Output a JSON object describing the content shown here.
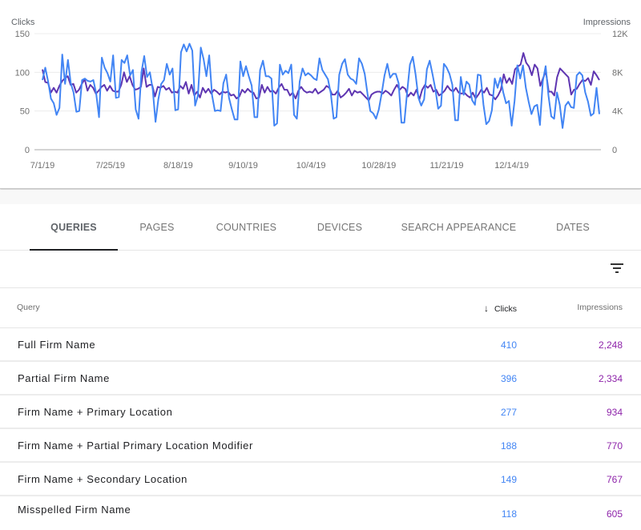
{
  "chart_data": {
    "type": "line",
    "title": "",
    "left_axis": {
      "label": "Clicks",
      "ticks": [
        "0",
        "50",
        "100",
        "150"
      ],
      "range": [
        0,
        150
      ]
    },
    "right_axis": {
      "label": "Impressions",
      "ticks": [
        "0",
        "4K",
        "8K",
        "12K"
      ],
      "range": [
        0,
        12000
      ]
    },
    "x_ticks": [
      "7/1/19",
      "7/25/19",
      "8/18/19",
      "9/10/19",
      "10/4/19",
      "10/28/19",
      "11/21/19",
      "12/14/19"
    ],
    "x_range": [
      "7/1/19",
      "12/31/19"
    ],
    "grid": true,
    "series": [
      {
        "name": "Clicks",
        "axis": "left",
        "color": "#4285f4",
        "values": [
          90,
          106,
          88,
          66,
          60,
          45,
          54,
          123,
          85,
          116,
          86,
          74,
          49,
          50,
          90,
          92,
          89,
          88,
          90,
          73,
          42,
          119,
          106,
          99,
          88,
          122,
          67,
          68,
          116,
          112,
          122,
          96,
          103,
          52,
          40,
          100,
          121,
          94,
          100,
          78,
          36,
          65,
          85,
          90,
          111,
          97,
          105,
          51,
          52,
          126,
          136,
          127,
          137,
          128,
          57,
          70,
          132,
          117,
          95,
          122,
          70,
          50,
          51,
          50,
          86,
          97,
          67,
          52,
          39,
          39,
          114,
          95,
          108,
          95,
          83,
          42,
          42,
          103,
          115,
          95,
          95,
          92,
          31,
          34,
          110,
          97,
          102,
          99,
          110,
          45,
          40,
          88,
          105,
          96,
          99,
          96,
          92,
          90,
          118,
          103,
          97,
          91,
          73,
          40,
          42,
          97,
          111,
          117,
          97,
          92,
          90,
          85,
          118,
          111,
          98,
          72,
          50,
          47,
          40,
          52,
          73,
          96,
          111,
          93,
          98,
          98,
          86,
          35,
          35,
          74,
          110,
          120,
          97,
          67,
          57,
          65,
          104,
          115,
          97,
          78,
          53,
          57,
          111,
          106,
          98,
          84,
          38,
          38,
          94,
          71,
          88,
          84,
          64,
          58,
          97,
          96,
          58,
          33,
          37,
          51,
          92,
          80,
          93,
          74,
          60,
          63,
          31,
          63,
          109,
          92,
          109,
          80,
          62,
          46,
          56,
          58,
          32,
          88,
          108,
          70,
          43,
          40,
          74,
          58,
          28,
          57,
          62,
          55,
          54,
          96,
          100,
          96,
          74,
          62,
          44,
          47,
          80,
          46
        ],
        "values_note": "approximate daily values read from chart"
      },
      {
        "name": "Impressions",
        "axis": "right",
        "color": "#5e35b1",
        "values": [
          8300,
          7000,
          6900,
          5900,
          6400,
          5900,
          6600,
          7100,
          7400,
          7600,
          6700,
          6800,
          5900,
          6200,
          6800,
          7300,
          6100,
          6700,
          6400,
          5800,
          6100,
          6500,
          6700,
          6100,
          6600,
          6100,
          6000,
          6000,
          6700,
          8000,
          7000,
          7600,
          6700,
          6200,
          6300,
          6500,
          8400,
          6500,
          6700,
          6700,
          5500,
          6500,
          6400,
          6600,
          6200,
          6400,
          5900,
          6000,
          5900,
          6600,
          6300,
          7000,
          5800,
          6700,
          5600,
          6000,
          5400,
          6400,
          5900,
          6300,
          5800,
          6200,
          6000,
          5700,
          6000,
          5900,
          6000,
          5600,
          5700,
          5300,
          5500,
          6200,
          5900,
          6300,
          6000,
          5900,
          5300,
          5400,
          6700,
          5900,
          6500,
          6000,
          6100,
          5800,
          6400,
          6800,
          6200,
          6200,
          5600,
          5900,
          5300,
          6100,
          6500,
          6100,
          5900,
          6000,
          5900,
          6300,
          5800,
          6000,
          6200,
          6600,
          6400,
          5700,
          5700,
          6100,
          5400,
          5600,
          5900,
          6300,
          5600,
          6100,
          5900,
          6000,
          5700,
          5400,
          5100,
          5700,
          5900,
          6000,
          6000,
          5800,
          6100,
          5900,
          5600,
          6200,
          6700,
          6200,
          6500,
          6300,
          5500,
          5900,
          5600,
          6200,
          5200,
          6200,
          6700,
          6400,
          6700,
          6000,
          6200,
          5600,
          5800,
          6100,
          6600,
          6200,
          6000,
          6400,
          5900,
          5800,
          5900,
          5600,
          5400,
          5900,
          5300,
          5700,
          6200,
          5900,
          6400,
          5700,
          5600,
          5200,
          5600,
          6200,
          7800,
          6900,
          7400,
          6800,
          8300,
          8600,
          8800,
          10000,
          9000,
          8600,
          7700,
          8800,
          8400,
          6600,
          7400,
          8100,
          6000,
          6000,
          5600,
          7500,
          8400,
          8100,
          7800,
          7500,
          5700,
          6200,
          6300,
          6800,
          7200,
          7100,
          7400,
          6700,
          8100,
          7700,
          7200
        ]
      }
    ]
  },
  "chart": {
    "left_axis_title": "Clicks",
    "right_axis_title": "Impressions",
    "left_ticks": [
      "0",
      "50",
      "100",
      "150"
    ],
    "right_ticks": [
      "0",
      "4K",
      "8K",
      "12K"
    ],
    "x_ticks": [
      "7/1/19",
      "7/25/19",
      "8/18/19",
      "9/10/19",
      "10/4/19",
      "10/28/19",
      "11/21/19",
      "12/14/19"
    ]
  },
  "tabs": [
    {
      "label": "QUERIES",
      "active": true
    },
    {
      "label": "PAGES",
      "active": false
    },
    {
      "label": "COUNTRIES",
      "active": false
    },
    {
      "label": "DEVICES",
      "active": false
    },
    {
      "label": "SEARCH APPEARANCE",
      "active": false
    },
    {
      "label": "DATES",
      "active": false
    }
  ],
  "filter": {
    "icon": "filter-list-icon"
  },
  "table": {
    "headers": {
      "query": "Query",
      "clicks": "Clicks",
      "impressions": "Impressions",
      "sort_icon": "arrow-downward-icon",
      "sort_glyph": "↓"
    },
    "rows": [
      {
        "query": "Full Firm Name",
        "clicks": "410",
        "impressions": "2,248"
      },
      {
        "query": "Partial Firm Name",
        "clicks": "396",
        "impressions": "2,334"
      },
      {
        "query": "Firm Name + Primary Location",
        "clicks": "277",
        "impressions": "934"
      },
      {
        "query": "Firm Name + Partial Primary Location Modifier",
        "clicks": "188",
        "impressions": "770"
      },
      {
        "query": "Firm Name + Secondary Location",
        "clicks": "149",
        "impressions": "767"
      },
      {
        "query": "Misspelled Firm Name",
        "clicks": "118",
        "impressions": "605"
      }
    ]
  },
  "colors": {
    "clicks": "#4285f4",
    "impressions": "#5e35b1",
    "impressions_text": "#8e24aa",
    "active_tab_indicator": "#202124"
  }
}
